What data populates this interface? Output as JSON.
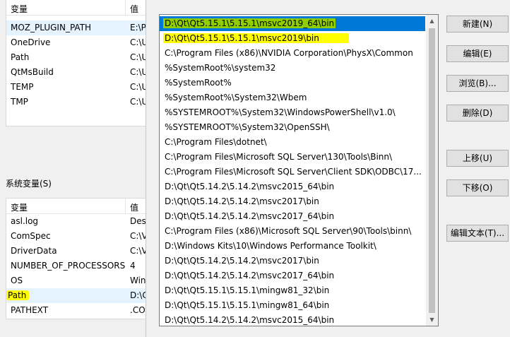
{
  "user_vars": {
    "header": {
      "name": "变量",
      "value": "值"
    },
    "rows": [
      {
        "name": "MOZ_PLUGIN_PATH",
        "value": "E:\\P"
      },
      {
        "name": "OneDrive",
        "value": "C:\\U"
      },
      {
        "name": "Path",
        "value": "C:\\U"
      },
      {
        "name": "QtMsBuild",
        "value": "C:\\U"
      },
      {
        "name": "TEMP",
        "value": "C:\\U"
      },
      {
        "name": "TMP",
        "value": "C:\\U"
      }
    ]
  },
  "sys_vars": {
    "label": "系统变量(S)",
    "header": {
      "name": "变量",
      "value": "值"
    },
    "rows": [
      {
        "name": "asl.log",
        "value": "Des"
      },
      {
        "name": "ComSpec",
        "value": "C:\\V"
      },
      {
        "name": "DriverData",
        "value": "C:\\V"
      },
      {
        "name": "NUMBER_OF_PROCESSORS",
        "value": "4"
      },
      {
        "name": "OS",
        "value": "Win"
      },
      {
        "name": "Path",
        "value": "D:\\C"
      },
      {
        "name": "PATHEXT",
        "value": ".CO"
      }
    ]
  },
  "path_entries": [
    "D:\\Qt\\Qt5.15.1\\5.15.1\\msvc2019_64\\bin",
    "D:\\Qt\\Qt5.15.1\\5.15.1\\msvc2019\\bin",
    "C:\\Program Files (x86)\\NVIDIA Corporation\\PhysX\\Common",
    "%SystemRoot%\\system32",
    "%SystemRoot%",
    "%SystemRoot%\\System32\\Wbem",
    "%SYSTEMROOT%\\System32\\WindowsPowerShell\\v1.0\\",
    "%SYSTEMROOT%\\System32\\OpenSSH\\",
    "C:\\Program Files\\dotnet\\",
    "C:\\Program Files\\Microsoft SQL Server\\130\\Tools\\Binn\\",
    "C:\\Program Files\\Microsoft SQL Server\\Client SDK\\ODBC\\17...",
    "D:\\Qt\\Qt5.14.2\\5.14.2\\msvc2015_64\\bin",
    "D:\\Qt\\Qt5.14.2\\5.14.2\\msvc2017\\bin",
    "D:\\Qt\\Qt5.14.2\\5.14.2\\msvc2017_64\\bin",
    "C:\\Program Files (x86)\\Microsoft SQL Server\\90\\Tools\\binn\\",
    "D:\\Windows Kits\\10\\Windows Performance Toolkit\\",
    "D:\\Qt\\Qt5.14.2\\5.14.2\\msvc2017\\bin",
    "D:\\Qt\\Qt5.14.2\\5.14.2\\msvc2017_64\\bin",
    "D:\\Qt\\Qt5.15.1\\5.15.1\\mingw81_32\\bin",
    "D:\\Qt\\Qt5.15.1\\5.15.1\\mingw81_64\\bin",
    "D:\\Qt\\Qt5.14.2\\5.14.2\\msvc2015_64\\bin"
  ],
  "buttons": {
    "new": "新建(N)",
    "edit": "编辑(E)",
    "browse": "浏览(B)...",
    "delete": "删除(D)",
    "move_up": "上移(U)",
    "move_down": "下移(O)",
    "edit_text": "编辑文本(T)..."
  },
  "colors": {
    "selection": "#0078d7",
    "highlight_green": "#8fcf00",
    "highlight_yellow": "#ffff00"
  }
}
